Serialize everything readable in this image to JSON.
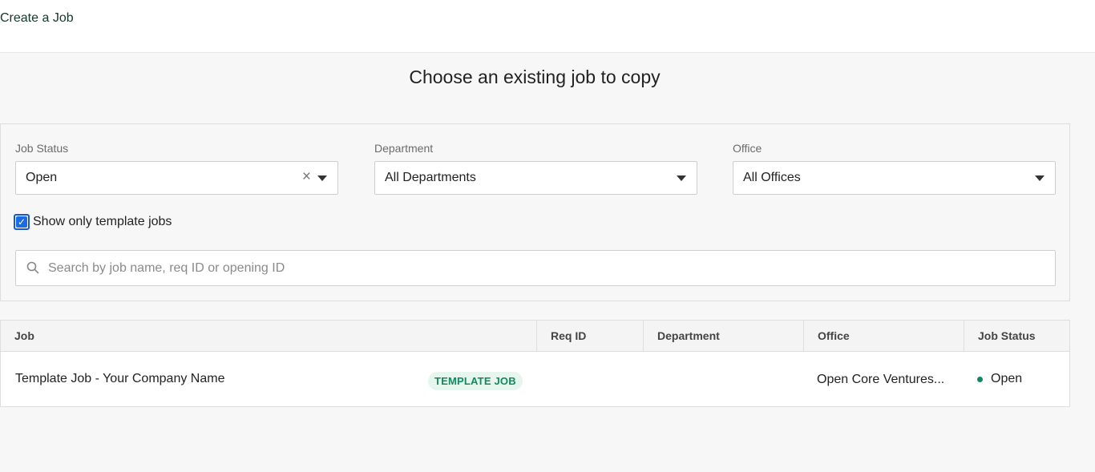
{
  "header": {
    "breadcrumb": "Create a Job"
  },
  "page": {
    "title": "Choose an existing job to copy"
  },
  "filters": {
    "job_status": {
      "label": "Job Status",
      "value": "Open"
    },
    "department": {
      "label": "Department",
      "value": "All Departments"
    },
    "office": {
      "label": "Office",
      "value": "All Offices"
    },
    "template_only": {
      "label": "Show only template jobs",
      "checked": true
    },
    "search": {
      "placeholder": "Search by job name, req ID or opening ID",
      "value": ""
    }
  },
  "table": {
    "columns": [
      "Job",
      "Req ID",
      "Department",
      "Office",
      "Job Status"
    ],
    "rows": [
      {
        "job": "Template Job - Your Company Name",
        "badge": "TEMPLATE JOB",
        "req_id": "",
        "department": "",
        "office": "Open Core Ventures...",
        "status": "Open"
      }
    ]
  },
  "colors": {
    "accent": "#15372c",
    "status_open": "#0f8a5f",
    "badge_bg": "#e6f6ef",
    "badge_text": "#108a5e",
    "checkbox": "#1a6ce0"
  }
}
